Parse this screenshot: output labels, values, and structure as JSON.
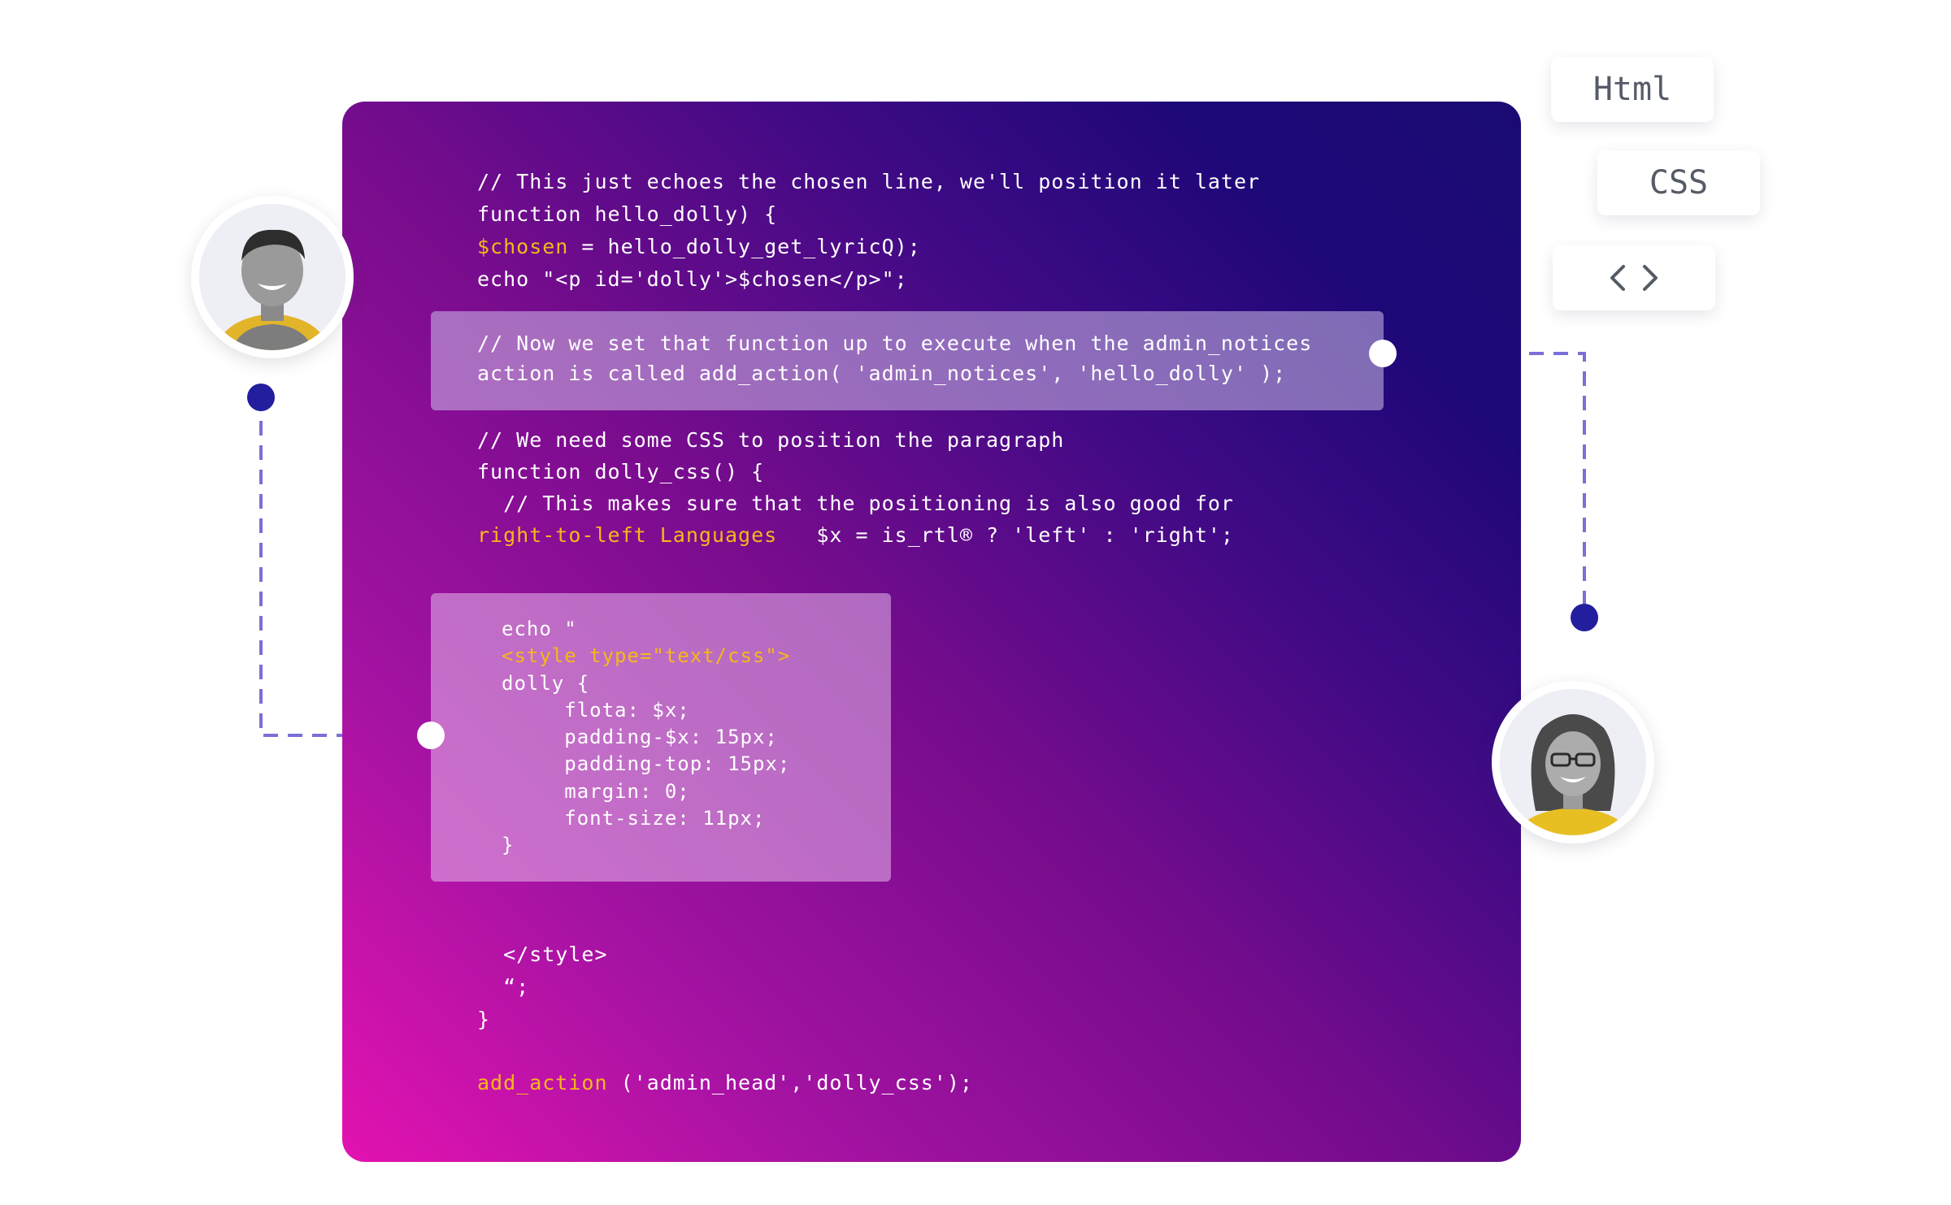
{
  "tags": {
    "html": "Html",
    "css": "CSS",
    "code_icon": "code-brackets-icon"
  },
  "code": {
    "block1_line1": "// This just echoes the chosen line, we'll position it later",
    "block1_line2": "function hello_dolly) {",
    "block1_line3_var": "$chosen",
    "block1_line3_rest": " = hello_dolly_get_lyricQ);",
    "block1_line4": "echo \"<p id='dolly'>$chosen</p>\";",
    "highlight1_line1": "// Now we set that function up to execute when the admin_notices",
    "highlight1_line2": "action is called add_action( 'admin_notices', 'hello_dolly' );",
    "block2_line1": "// We need some CSS to position the paragraph",
    "block2_line2": "function dolly_css() {",
    "block2_line3": "  // This makes sure that the positioning is also good for",
    "block2_line4_hl": "right-to-left Languages",
    "block2_line4_rest": "   $x = is_rtl® ? 'left' : 'right';",
    "highlight2_line1": "echo \"",
    "highlight2_line2": "<style type=\"text/css\">",
    "highlight2_line3": "dolly {",
    "highlight2_line4": "     flota: $x;",
    "highlight2_line5": "     padding-$x: 15px;",
    "highlight2_line6": "     padding-top: 15px;",
    "highlight2_line7": "     margin: 0;",
    "highlight2_line8": "     font-size: 11px;",
    "highlight2_line9": "}",
    "block3_line1": "  </style>",
    "block3_line2": "  “;",
    "block3_line3": "}",
    "block4_fn": "add_action",
    "block4_rest": " ('admin_head','dolly_css');"
  },
  "colors": {
    "accent_yellow": "#f6b71a",
    "connector_blue": "#231e9e",
    "dashed_line": "#7a6fd8",
    "gradient_pink": "#e312b0",
    "gradient_navy": "#1a0a72"
  }
}
